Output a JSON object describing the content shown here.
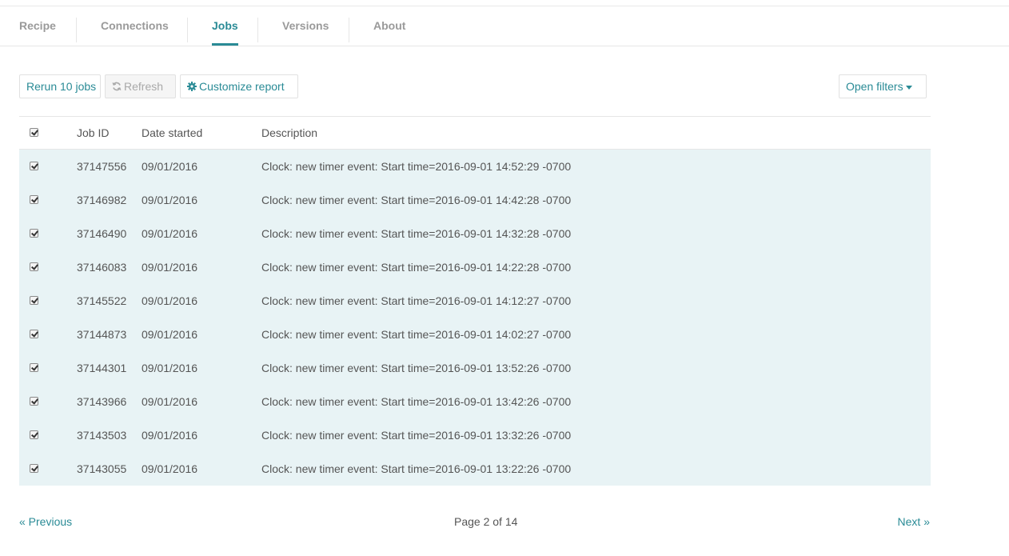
{
  "tabs": [
    {
      "label": "Recipe",
      "active": false
    },
    {
      "label": "Connections",
      "active": false
    },
    {
      "label": "Jobs",
      "active": true
    },
    {
      "label": "Versions",
      "active": false
    },
    {
      "label": "About",
      "active": false
    }
  ],
  "toolbar": {
    "rerun_label": "Rerun 10 jobs",
    "refresh_label": "Refresh",
    "refresh_icon": "refresh-icon",
    "customize_label": "Customize report",
    "customize_icon": "gear-icon",
    "filters_label": "Open filters"
  },
  "table": {
    "headers": {
      "job_id": "Job ID",
      "date_started": "Date started",
      "description": "Description"
    },
    "rows": [
      {
        "checked": true,
        "job_id": "37147556",
        "date": "09/01/2016",
        "description": "Clock: new timer event: Start time=2016-09-01 14:52:29 -0700"
      },
      {
        "checked": true,
        "job_id": "37146982",
        "date": "09/01/2016",
        "description": "Clock: new timer event: Start time=2016-09-01 14:42:28 -0700"
      },
      {
        "checked": true,
        "job_id": "37146490",
        "date": "09/01/2016",
        "description": "Clock: new timer event: Start time=2016-09-01 14:32:28 -0700"
      },
      {
        "checked": true,
        "job_id": "37146083",
        "date": "09/01/2016",
        "description": "Clock: new timer event: Start time=2016-09-01 14:22:28 -0700"
      },
      {
        "checked": true,
        "job_id": "37145522",
        "date": "09/01/2016",
        "description": "Clock: new timer event: Start time=2016-09-01 14:12:27 -0700"
      },
      {
        "checked": true,
        "job_id": "37144873",
        "date": "09/01/2016",
        "description": "Clock: new timer event: Start time=2016-09-01 14:02:27 -0700"
      },
      {
        "checked": true,
        "job_id": "37144301",
        "date": "09/01/2016",
        "description": "Clock: new timer event: Start time=2016-09-01 13:52:26 -0700"
      },
      {
        "checked": true,
        "job_id": "37143966",
        "date": "09/01/2016",
        "description": "Clock: new timer event: Start time=2016-09-01 13:42:26 -0700"
      },
      {
        "checked": true,
        "job_id": "37143503",
        "date": "09/01/2016",
        "description": "Clock: new timer event: Start time=2016-09-01 13:32:26 -0700"
      },
      {
        "checked": true,
        "job_id": "37143055",
        "date": "09/01/2016",
        "description": "Clock: new timer event: Start time=2016-09-01 13:22:26 -0700"
      }
    ]
  },
  "pagination": {
    "previous_label": "« Previous",
    "page_info": "Page 2 of 14",
    "next_label": "Next »"
  },
  "colors": {
    "accent": "#2a8b96",
    "selected_row_bg": "#e8f3f5"
  }
}
